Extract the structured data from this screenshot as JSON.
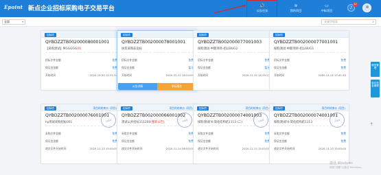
{
  "header": {
    "logo": "Epoint",
    "title": "新点企业招标采购电子交易平台",
    "nav": [
      {
        "label": "公告任务",
        "icon": "megaphone-icon",
        "glyph": "🔊"
      },
      {
        "label": "我的项目",
        "icon": "layers-icon",
        "glyph": "≋"
      },
      {
        "label": "中标项目",
        "icon": "folder-icon",
        "glyph": "▭"
      }
    ],
    "notification_count": "12"
  },
  "toolbar": {
    "filter_value": "全部",
    "search_placeholder": "关键字搜索"
  },
  "colors": {
    "brand": "#1f7fd8",
    "highlight": "#d12a2a",
    "orange": "#f5a43a",
    "red_text": "#e23b3b"
  },
  "cards": [
    {
      "badge": "招标项",
      "status": "",
      "code": "QYBDZZTB002000080001001",
      "name_pre": "【采购测试】MGGGGG",
      "name_red": "(R)",
      "rows": [
        {
          "label": "招标文件金额",
          "value": "免费",
          "plain": false
        },
        {
          "label": "保证金金额",
          "value": "免费",
          "plain": false
        },
        {
          "label": "开始时间",
          "value": "2020-12-30 11:31:34",
          "plain": true
        }
      ],
      "stamp": "",
      "buttons": null
    },
    {
      "badge": "招标项",
      "status": "",
      "code": "QYBDZZTB002000078001001",
      "name_pre": "扶贫采购非竞标",
      "name_red": "",
      "rows": [
        {
          "label": "招标文件金额",
          "value": "免费",
          "plain": false
        },
        {
          "label": "保证金金额",
          "value": "暂无",
          "plain": false
        },
        {
          "label": "开始时间",
          "value": "2020-12-12 16:24:59",
          "plain": true
        }
      ],
      "stamp": "",
      "buttons": {
        "left": "公告详情",
        "right": "参标报名"
      }
    },
    {
      "badge": "招标项",
      "status": "",
      "code": "QYBDZZTB002000077001003",
      "name_pre": "採购测试-中期项目-招以BUG2",
      "name_red": "",
      "rows": [
        {
          "label": "招标文件金额",
          "value": "免费",
          "plain": false
        },
        {
          "label": "保证金金额",
          "value": "暂无",
          "plain": false
        },
        {
          "label": "开始时间",
          "value": "2020-12-12 14:29:27",
          "plain": true
        }
      ],
      "stamp": "",
      "buttons": null
    },
    {
      "badge": "招标项",
      "status": "",
      "code": "QYBDZZTB002000077001001",
      "name_pre": "採购测试-中期项目-招以BUG1",
      "name_red": "",
      "rows": [
        {
          "label": "招标文件金额",
          "value": "免费",
          "plain": false
        },
        {
          "label": "保证金金额",
          "value": "免费",
          "plain": false
        },
        {
          "label": "开始时间",
          "value": "2020-11-14 17:41:45",
          "plain": true
        }
      ],
      "stamp": "",
      "buttons": null
    },
    {
      "badge": "招标项",
      "status": "项目的结束价 (项目)",
      "code": "QYBDZZTB002000076001001",
      "name_pre": "hy测试采购招标001",
      "name_red": "",
      "rows": [
        {
          "label": "采购文件金额",
          "value": "免费",
          "plain": false
        },
        {
          "label": "保证金金额",
          "value": "免费",
          "plain": false
        },
        {
          "label": "递交文件开始时间",
          "value": "2020-11-13 15:00:00",
          "plain": true
        }
      ],
      "stamp": "已结束",
      "buttons": null
    },
    {
      "badge": "招标项",
      "status": "项目的结束价 (项目)",
      "code": "QYBDZZTB002000066001002",
      "name_pre": "测试公开招标111200",
      "name_red": "(重新公告)",
      "rows": [
        {
          "label": "采购文件金额",
          "value": "免费",
          "plain": false
        },
        {
          "label": "保证金金额",
          "value": "免费",
          "plain": false
        },
        {
          "label": "递交文件开始时间",
          "value": "2020-11-14 08:00:00",
          "plain": true
        }
      ],
      "stamp": "已结束",
      "buttons": null
    },
    {
      "badge": "招标项",
      "status": "项目的结束价 (项目)",
      "code": "QYBDZZTB002000074001003",
      "name_pre": "採购测试FK-简化结构结1113 (二)",
      "name_red": "",
      "rows": [
        {
          "label": "采购文件金额",
          "value": "免费",
          "plain": false
        },
        {
          "label": "保证金金额",
          "value": "免费",
          "plain": false
        },
        {
          "label": "递交文件开始时间",
          "value": "2020-11-13 15:00:00",
          "plain": true
        }
      ],
      "stamp": "已结束",
      "buttons": null
    },
    {
      "badge": "招标项",
      "status": "项目的结束价 (项目)",
      "code": "QYBDZZTB002000074001001",
      "name_pre": "採购测试FK-简化结构结1113",
      "name_red": "",
      "rows": [
        {
          "label": "采购文件金额",
          "value": "免费",
          "plain": false
        },
        {
          "label": "保证金金额",
          "value": "免费",
          "plain": false
        },
        {
          "label": "递交文件开始时间",
          "value": "2020-11-13 15:00:00",
          "plain": true
        }
      ],
      "stamp": "已结束",
      "buttons": null
    }
  ],
  "side_buttons": [
    {
      "label": "服务管理"
    },
    {
      "label": "单位信息管理"
    }
  ],
  "watermark": {
    "line1": "激活 Windows",
    "line2": "转到\"设置\"以激活 Windows。"
  }
}
